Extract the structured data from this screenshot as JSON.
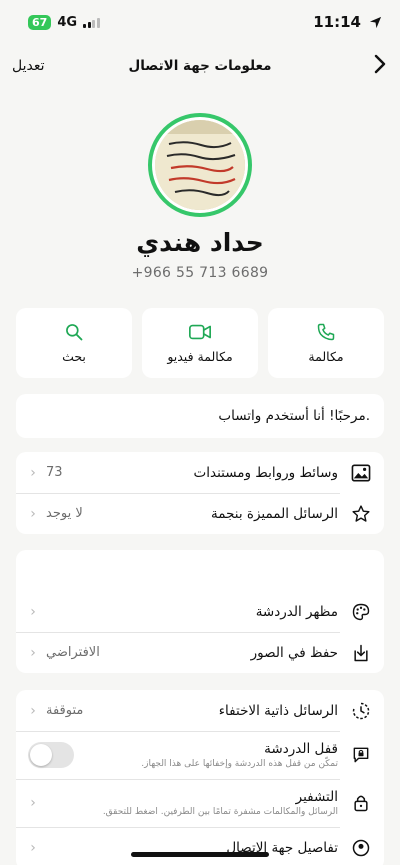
{
  "status": {
    "battery": "67",
    "network": "4G",
    "time": "11:14"
  },
  "nav": {
    "edit_label": "تعديل",
    "title": "معلومات جهة الاتصال"
  },
  "contact": {
    "name": "حداد هندي",
    "phone": "+966 55 713 6689",
    "about": "مرحبًا! أنا أستخدم واتساب."
  },
  "actions": [
    {
      "label": "مكالمة",
      "icon": "phone-icon"
    },
    {
      "label": "مكالمة فيديو",
      "icon": "video-icon"
    },
    {
      "label": "بحث",
      "icon": "search-icon"
    }
  ],
  "media": {
    "label": "وسائط وروابط ومستندات",
    "value": "73",
    "icon": "image-icon"
  },
  "starred": {
    "label": "الرسائل المميزة بنجمة",
    "value": "لا يوجد",
    "icon": "star-icon"
  },
  "chat_theme": {
    "label": "مظهر الدردشة",
    "icon": "palette-icon"
  },
  "save_to_photos": {
    "label": "حفظ في الصور",
    "value": "الافتراضي",
    "icon": "download-icon"
  },
  "disappearing": {
    "label": "الرسائل ذاتية الاختفاء",
    "value": "متوقفة",
    "icon": "timer-icon"
  },
  "chat_lock": {
    "label": "قفل الدردشة",
    "sub": "تمكّن من قفل هذه الدردشة وإخفائها على هذا الجهاز.",
    "icon": "chat-lock-icon",
    "enabled": false
  },
  "encryption": {
    "label": "التشفير",
    "sub": "الرسائل والمكالمات مشفرة تمامًا بين الطرفين. اضغط للتحقق.",
    "icon": "lock-icon"
  },
  "contact_details": {
    "label": "تفاصيل جهة الاتصال",
    "icon": "contact-icon"
  },
  "colors": {
    "accent": "#1fa855",
    "avatar_ring": "#36c76a",
    "battery": "#34c759"
  }
}
